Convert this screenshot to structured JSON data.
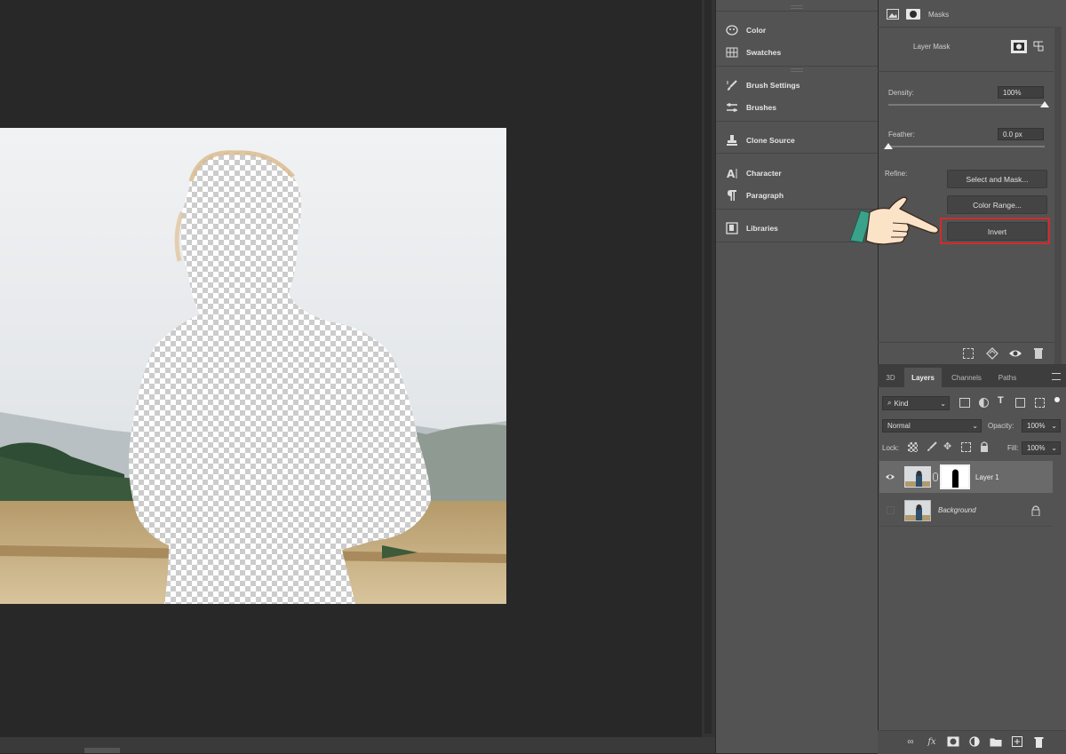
{
  "dock_panels": [
    {
      "label": "Color",
      "icon": "color-wheel-icon"
    },
    {
      "label": "Swatches",
      "icon": "swatches-grid-icon"
    },
    {
      "label": "Brush Settings",
      "icon": "brush-settings-icon"
    },
    {
      "label": "Brushes",
      "icon": "brush-icon"
    },
    {
      "label": "Clone Source",
      "icon": "clone-stamp-icon"
    },
    {
      "label": "Character",
      "icon": "character-icon"
    },
    {
      "label": "Paragraph",
      "icon": "paragraph-icon"
    },
    {
      "label": "Libraries",
      "icon": "libraries-icon"
    }
  ],
  "properties": {
    "masks_label": "Masks",
    "layer_mask_label": "Layer Mask",
    "density_label": "Density:",
    "density_value": "100%",
    "density_level": 1.0,
    "feather_label": "Feather:",
    "feather_value": "0.0 px",
    "feather_level": 0.0,
    "refine_label": "Refine:",
    "select_and_mask": "Select and Mask...",
    "color_range": "Color Range...",
    "invert": "Invert",
    "highlight_color": "#d42a2a"
  },
  "layers_panel": {
    "tabs": [
      "3D",
      "Layers",
      "Channels",
      "Paths"
    ],
    "active_tab": "Layers",
    "filter_kind": "Kind",
    "blend_mode": "Normal",
    "opacity_label": "Opacity:",
    "opacity_value": "100%",
    "lock_label": "Lock:",
    "fill_label": "Fill:",
    "fill_value": "100%",
    "layers": [
      {
        "name": "Layer 1",
        "visible": true,
        "has_mask": true
      },
      {
        "name": "Background",
        "visible": false,
        "locked": true
      }
    ]
  },
  "colors": {
    "accent_pointer_cuff": "#3aa28a",
    "panel_bg": "#535353",
    "canvas_bg": "#282828"
  }
}
